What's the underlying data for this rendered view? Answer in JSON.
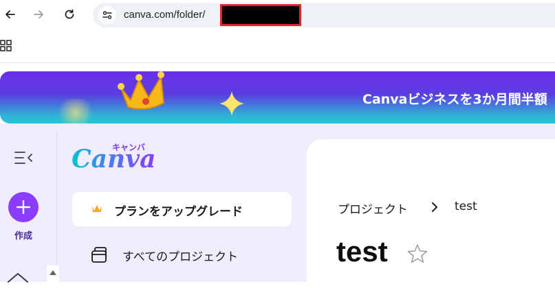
{
  "browser": {
    "url": "canva.com/folder/",
    "icons": {
      "back": "back-arrow-icon",
      "forward": "forward-arrow-icon",
      "reload": "reload-icon",
      "site_info": "site-settings-icon",
      "apps": "apps-grid-icon"
    }
  },
  "banner": {
    "text": "Canvaビジネスを3か月間半額",
    "icons": [
      "crown-icon",
      "sparkle-icon"
    ]
  },
  "rail": {
    "create_label": "作成",
    "icons": [
      "sidebar-toggle-icon",
      "plus-icon",
      "home-icon"
    ]
  },
  "sidebar": {
    "logo_word": "Canva",
    "logo_kana": "キャンバ",
    "upgrade_label": "プランをアップグレード",
    "all_projects_label": "すべてのプロジェクト"
  },
  "content": {
    "breadcrumb_root": "プロジェクト",
    "breadcrumb_current": "test",
    "title": "test"
  },
  "colors": {
    "brand_purple": "#8b3dff",
    "banner_top": "#6a2ee8",
    "banner_bottom": "#25c5d3",
    "sidebar_bg": "#f0ecfb",
    "redaction_border": "#e0262b"
  }
}
